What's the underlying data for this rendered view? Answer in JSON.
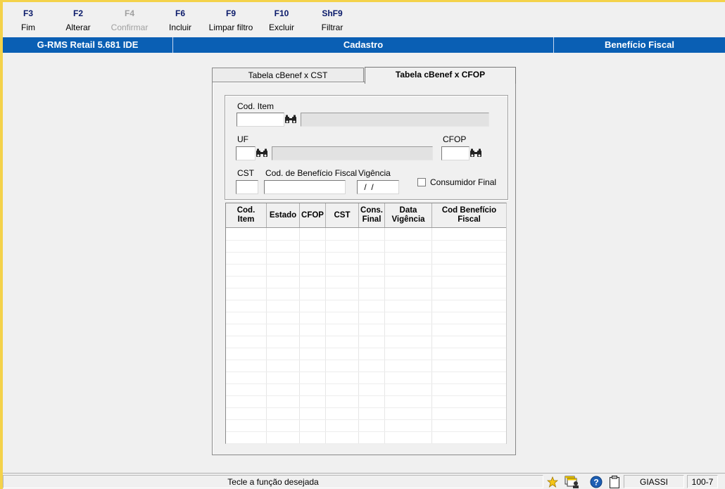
{
  "toolbar": {
    "keys": [
      {
        "key": "F3",
        "label": "Fim"
      },
      {
        "key": "F2",
        "label": "Alterar"
      },
      {
        "key": "F4",
        "label": "Confirmar"
      },
      {
        "key": "F6",
        "label": "Incluir"
      },
      {
        "key": "F9",
        "label": "Limpar filtro"
      },
      {
        "key": "F10",
        "label": "Excluir"
      },
      {
        "key": "ShF9",
        "label": "Filtrar"
      }
    ]
  },
  "titlebar": {
    "app": "G-RMS Retail 5.681 IDE",
    "module": "Cadastro",
    "screen": "Benefício Fiscal"
  },
  "tabs": [
    {
      "label": "Tabela cBenef x CST"
    },
    {
      "label": "Tabela cBenef x CFOP"
    }
  ],
  "form": {
    "cod_item_label": "Cod. Item",
    "cod_item_value": "",
    "uf_label": "UF",
    "uf_value": "",
    "cfop_label": "CFOP",
    "cfop_value": "",
    "cst_label": "CST",
    "cst_value": "",
    "cod_beneficio_label": "Cod. de Benefício Fiscal",
    "cod_beneficio_value": "",
    "vigencia_label": "Vigência",
    "vigencia_value": " /  /",
    "consumidor_final_label": "Consumidor Final"
  },
  "grid": {
    "columns": [
      {
        "l1": "Cod.",
        "l2": "Item"
      },
      {
        "l1": "Estado",
        "l2": ""
      },
      {
        "l1": "CFOP",
        "l2": ""
      },
      {
        "l1": "CST",
        "l2": ""
      },
      {
        "l1": "Cons.",
        "l2": "Final"
      },
      {
        "l1": "Data",
        "l2": "Vigência"
      },
      {
        "l1": "Cod Benefício",
        "l2": "Fiscal"
      }
    ]
  },
  "statusbar": {
    "message": "Tecle a função desejada",
    "user": "GIASSI",
    "code": "100-7"
  }
}
